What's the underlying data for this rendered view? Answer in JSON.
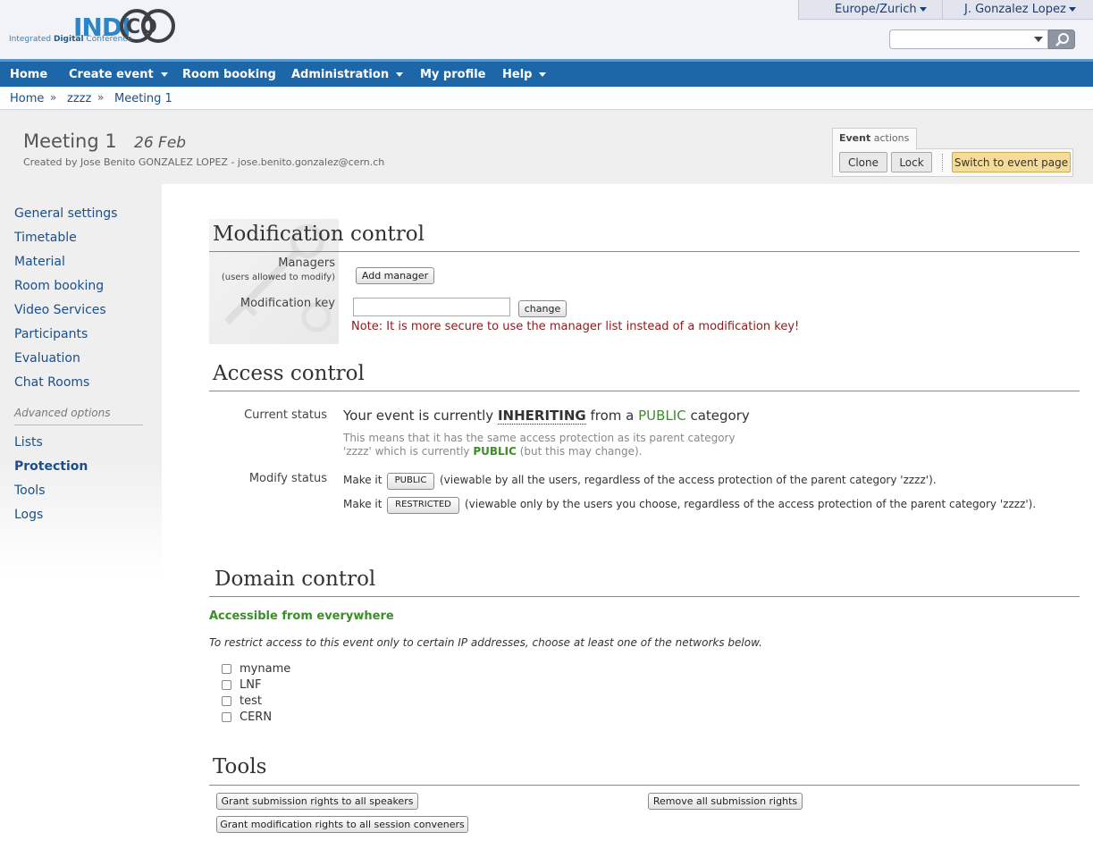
{
  "header": {
    "logo_word": "INDI",
    "logo_co": "CO",
    "logo_sub_1": "Integrated ",
    "logo_sub_2": "Digital",
    "logo_sub_3": " Conference",
    "timezone": "Europe/Zurich",
    "user": "J. Gonzalez Lopez",
    "search_value": ""
  },
  "menu": {
    "items": [
      {
        "label": "Home"
      },
      {
        "label": "Create event"
      },
      {
        "label": "Room booking"
      },
      {
        "label": "Administration"
      },
      {
        "label": "My profile"
      },
      {
        "label": "Help"
      }
    ]
  },
  "breadcrumb": {
    "items": [
      "Home",
      "zzzz",
      "Meeting 1"
    ],
    "separator": "»"
  },
  "event": {
    "title": "Meeting 1",
    "date": "26 Feb",
    "creator": "Created by Jose Benito GONZALEZ LOPEZ - jose.benito.gonzalez@cern.ch"
  },
  "actions": {
    "tab_bold": "Event",
    "tab_rest": " actions",
    "clone": "Clone",
    "lock": "Lock",
    "switch": "Switch to event page"
  },
  "sidebar": {
    "items": [
      {
        "label": "General settings"
      },
      {
        "label": "Timetable"
      },
      {
        "label": "Material"
      },
      {
        "label": "Room booking"
      },
      {
        "label": "Video Services"
      },
      {
        "label": "Participants"
      },
      {
        "label": "Evaluation"
      },
      {
        "label": "Chat Rooms"
      }
    ],
    "advanced_heading": "Advanced options",
    "advanced_items": [
      {
        "label": "Lists"
      },
      {
        "label": "Protection"
      },
      {
        "label": "Tools"
      },
      {
        "label": "Logs"
      }
    ]
  },
  "modification": {
    "title": "Modification control",
    "managers_label": "Managers",
    "managers_sub": "(users allowed to modify)",
    "add_manager": "Add manager",
    "key_label": "Modification key",
    "key_value": "",
    "change": "change",
    "note": "Note: It is more secure to use the manager list instead of a modification key!"
  },
  "access": {
    "title": "Access control",
    "current_label": "Current status",
    "status_pre": "Your event is currently ",
    "status_inherit": "INHERITING",
    "status_mid": " from a ",
    "status_public": "PUBLIC",
    "status_post": " category",
    "means_1": "This means that it has the same access protection as its parent category",
    "means_2_pre": "'zzzz' which is currently ",
    "means_2_public": "PUBLIC",
    "means_2_post": " (but this may change).",
    "modify_label": "Modify status",
    "make_it": "Make it",
    "public_btn": "PUBLIC",
    "public_desc": "(viewable by all the users, regardless of the access protection of the parent category 'zzzz').",
    "restricted_btn": "RESTRICTED",
    "restricted_desc": "(viewable only by the users you choose, regardless of the access protection of the parent category 'zzzz')."
  },
  "domain": {
    "title": "Domain control",
    "accessible": "Accessible from everywhere",
    "instruction": "To restrict access to this event only to certain IP addresses, choose at least one of the networks below.",
    "networks": [
      {
        "label": "myname"
      },
      {
        "label": "LNF"
      },
      {
        "label": "test"
      },
      {
        "label": "CERN"
      }
    ]
  },
  "tools": {
    "title": "Tools",
    "grant_speakers": "Grant submission rights to all speakers",
    "remove_rights": "Remove all submission rights",
    "grant_conveners": "Grant modification rights to all session conveners"
  }
}
